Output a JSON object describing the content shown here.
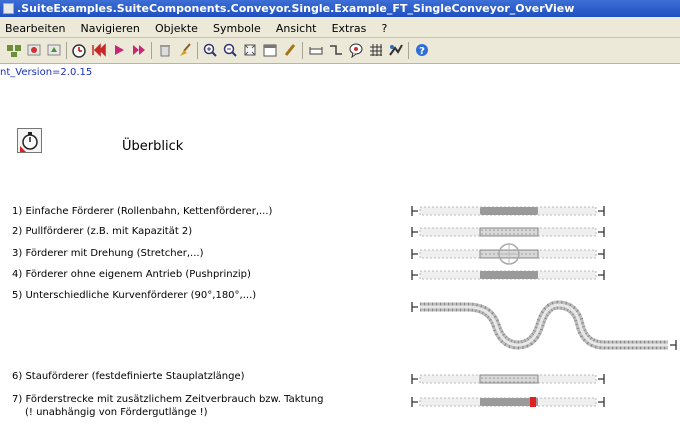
{
  "window": {
    "title": ".SuiteExamples.SuiteComponents.Conveyor.Single.Example_FT_SingleConveyor_OverView"
  },
  "menu": [
    "Bearbeiten",
    "Navigieren",
    "Objekte",
    "Symbole",
    "Ansicht",
    "Extras",
    "?"
  ],
  "toolbar": {
    "icons": [
      "layout-icon",
      "cut-icon",
      "copy-icon",
      "clock-icon",
      "stop-icon",
      "play-icon",
      "fast-forward-icon",
      "trash-icon",
      "broom-icon",
      "zoom-in-icon",
      "zoom-out-icon",
      "fit-icon",
      "calendar-icon",
      "pencil-icon",
      "conveyor-icon",
      "connector-icon",
      "chat-icon",
      "grid-icon",
      "path-icon",
      "help-icon"
    ]
  },
  "version_text": "nt_Version=2.0.15",
  "overview": {
    "title": "Überblick"
  },
  "items": [
    {
      "label": "1) Einfache Förderer (Rollenbahn, Kettenförderer,...)"
    },
    {
      "label": "2) Pullförderer (z.B. mit Kapazität 2)"
    },
    {
      "label": "3) Förderer mit Drehung (Stretcher,...)"
    },
    {
      "label": "4) Förderer ohne eigenem Antrieb (Pushprinzip)"
    },
    {
      "label": "5) Unterschiedliche Kurvenförderer (90°,180°,...)"
    },
    {
      "label": "6) Stauförderer (festdefinierte Stauplatzlänge)"
    },
    {
      "label": "7) Förderstrecke mit zusätzlichem Zeitverbrauch bzw. Taktung",
      "sub": "(! unabhängig von Fördergutlänge !)"
    }
  ],
  "colors": {
    "accent": "#e02020",
    "title_bar": "#2553c8",
    "version_text": "#1a2fbf"
  }
}
